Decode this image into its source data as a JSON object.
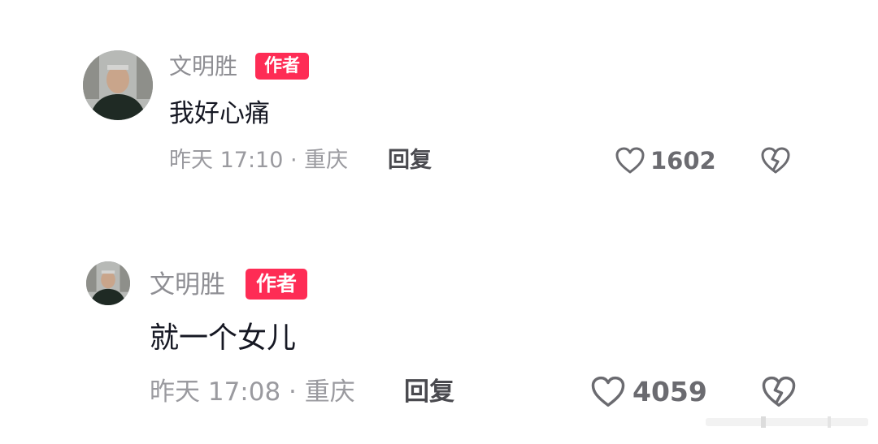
{
  "comments": [
    {
      "author": "文明胜",
      "author_badge": "作者",
      "text": "我好心痛",
      "time_location": "昨天 17:10 · 重庆",
      "reply_label": "回复",
      "like_count": "1602"
    },
    {
      "author": "文明胜",
      "author_badge": "作者",
      "text": "就一个女儿",
      "time_location": "昨天 17:08 · 重庆",
      "reply_label": "回复",
      "like_count": "4059"
    }
  ],
  "icons": {
    "like": "heart-outline-icon",
    "dislike": "broken-heart-icon"
  },
  "colors": {
    "author_badge": "#fe2c55",
    "username": "#8e8e93",
    "body_text": "#161823",
    "meta_text": "#9a9a9f"
  }
}
